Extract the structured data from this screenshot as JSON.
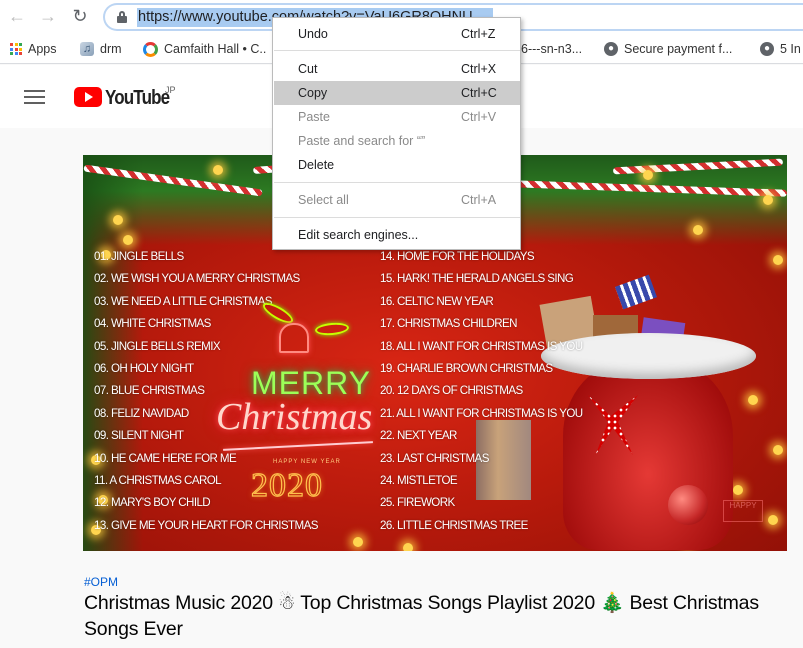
{
  "browser": {
    "nav": {
      "back_icon": "arrow-left-icon",
      "forward_icon": "arrow-right-icon",
      "reload_icon": "reload-icon"
    },
    "address_bar": {
      "url": "https://www.youtube.com/watch?v=VaU6GR8OHNU",
      "secure_icon": "lock-icon"
    },
    "bookmarks": [
      {
        "label": "Apps",
        "icon": "apps-grid-icon"
      },
      {
        "label": "drm",
        "icon": "music-icon"
      },
      {
        "label": "Camfaith Hall • C..",
        "icon": "camfaith-icon"
      },
      {
        "label": "6---sn-n3...",
        "icon": "none"
      },
      {
        "label": "Secure payment f...",
        "icon": "globe-icon"
      },
      {
        "label": "5 In",
        "icon": "globe-icon"
      }
    ]
  },
  "context_menu": {
    "items": [
      {
        "label": "Undo",
        "shortcut": "Ctrl+Z",
        "enabled": true
      },
      {
        "label": "Cut",
        "shortcut": "Ctrl+X",
        "enabled": true
      },
      {
        "label": "Copy",
        "shortcut": "Ctrl+C",
        "enabled": true,
        "highlighted": true
      },
      {
        "label": "Paste",
        "shortcut": "Ctrl+V",
        "enabled": false
      },
      {
        "label": "Paste and search for  “”",
        "shortcut": "",
        "enabled": false
      },
      {
        "label": "Delete",
        "shortcut": "",
        "enabled": true
      },
      {
        "label": "Select all",
        "shortcut": "Ctrl+A",
        "enabled": false
      },
      {
        "label": "Edit search engines...",
        "shortcut": "",
        "enabled": true
      }
    ]
  },
  "youtube": {
    "menu_icon": "hamburger-icon",
    "logo_text": "YouTube",
    "region": "JP"
  },
  "video": {
    "thumbnail": {
      "greeting_top": "MERRY",
      "greeting_script": "Christmas",
      "happy_new_year": "HAPPY NEW YEAR",
      "year": "2020",
      "stamp": "HAPPY",
      "songs_left": [
        "01. JINGLE BELLS",
        "02. WE WISH YOU A MERRY CHRISTMAS",
        "03. WE NEED A LITTLE CHRISTMAS",
        "04. WHITE CHRISTMAS",
        "05. JINGLE BELLS REMIX",
        "06. OH HOLY NIGHT",
        "07. BLUE CHRISTMAS",
        "08. FELIZ NAVIDAD",
        "09. SILENT NIGHT",
        "10. HE CAME HERE FOR ME",
        "11. A CHRISTMAS CAROL",
        "12. MARY'S BOY CHILD",
        "13. GIVE ME YOUR HEART FOR CHRISTMAS"
      ],
      "songs_right": [
        "14. HOME FOR THE HOLIDAYS",
        "15. HARK! THE HERALD ANGELS SING",
        "16. CELTIC NEW YEAR",
        "17. CHRISTMAS CHILDREN",
        "18. ALL I WANT FOR CHRISTMAS IS YOU",
        "19. CHARLIE BROWN CHRISTMAS",
        "20. 12 DAYS OF CHRISTMAS",
        "21. ALL I WANT FOR CHRISTMAS IS YOU",
        "22. NEXT YEAR",
        "23. LAST CHRISTMAS",
        "24. MISTLETOE",
        "25. FIREWORK",
        "26. LITTLE CHRISTMAS TREE"
      ]
    },
    "hashtag": "#OPM",
    "title": "Christmas Music 2020 ☃ Top Christmas Songs Playlist 2020 🎄 Best Christmas Songs Ever"
  }
}
